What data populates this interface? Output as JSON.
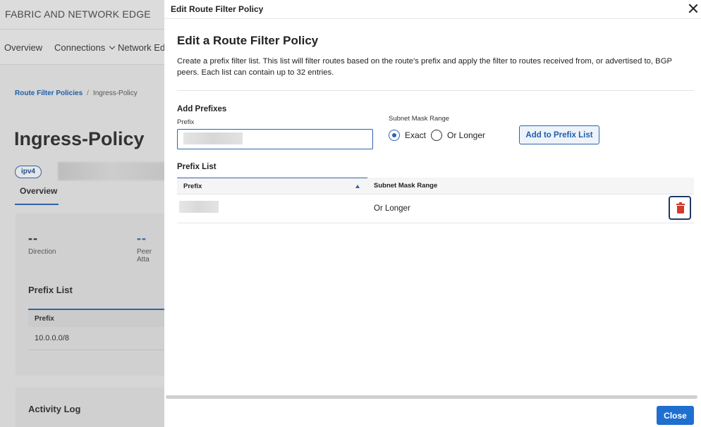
{
  "background": {
    "brand": "FABRIC AND NETWORK EDGE",
    "nav": [
      {
        "label": "Overview"
      },
      {
        "label": "Connections"
      },
      {
        "label": "Network Edg"
      }
    ],
    "breadcrumb": {
      "link": "Route Filter Policies",
      "separator": "/",
      "current": "Ingress-Policy"
    },
    "page_title": "Ingress-Policy",
    "badge": "ipv4",
    "tab": "Overview",
    "card": {
      "direction_value": "--",
      "direction_label": "Direction",
      "peer_value": "--",
      "peer_label": "Peer Atta",
      "prefix_list_title": "Prefix List",
      "table_header": "Prefix",
      "row_prefix": "10.0.0.0/8"
    },
    "activity_title": "Activity Log"
  },
  "drawer": {
    "title": "Edit Route Filter Policy",
    "heading": "Edit a Route Filter Policy",
    "description": "Create a prefix filter list. This list will filter routes based on the route's prefix and apply the filter to routes received from, or advertised to, BGP peers. Each list can contain up to 32 entries.",
    "add_prefixes": {
      "title": "Add Prefixes",
      "prefix_label": "Prefix",
      "prefix_value": "",
      "mask_label": "Subnet Mask Range",
      "options": [
        {
          "label": "Exact",
          "checked": true
        },
        {
          "label": "Or Longer",
          "checked": false
        }
      ],
      "add_button": "Add to Prefix List"
    },
    "prefix_list": {
      "title": "Prefix List",
      "columns": [
        "Prefix",
        "Subnet Mask Range"
      ],
      "rows": [
        {
          "prefix": "",
          "mask": "Or Longer"
        }
      ]
    },
    "close_button": "Close"
  },
  "colors": {
    "accent": "#2f64a8",
    "primary_button": "#1f6fcf",
    "delete_icon": "#d33a2c"
  }
}
